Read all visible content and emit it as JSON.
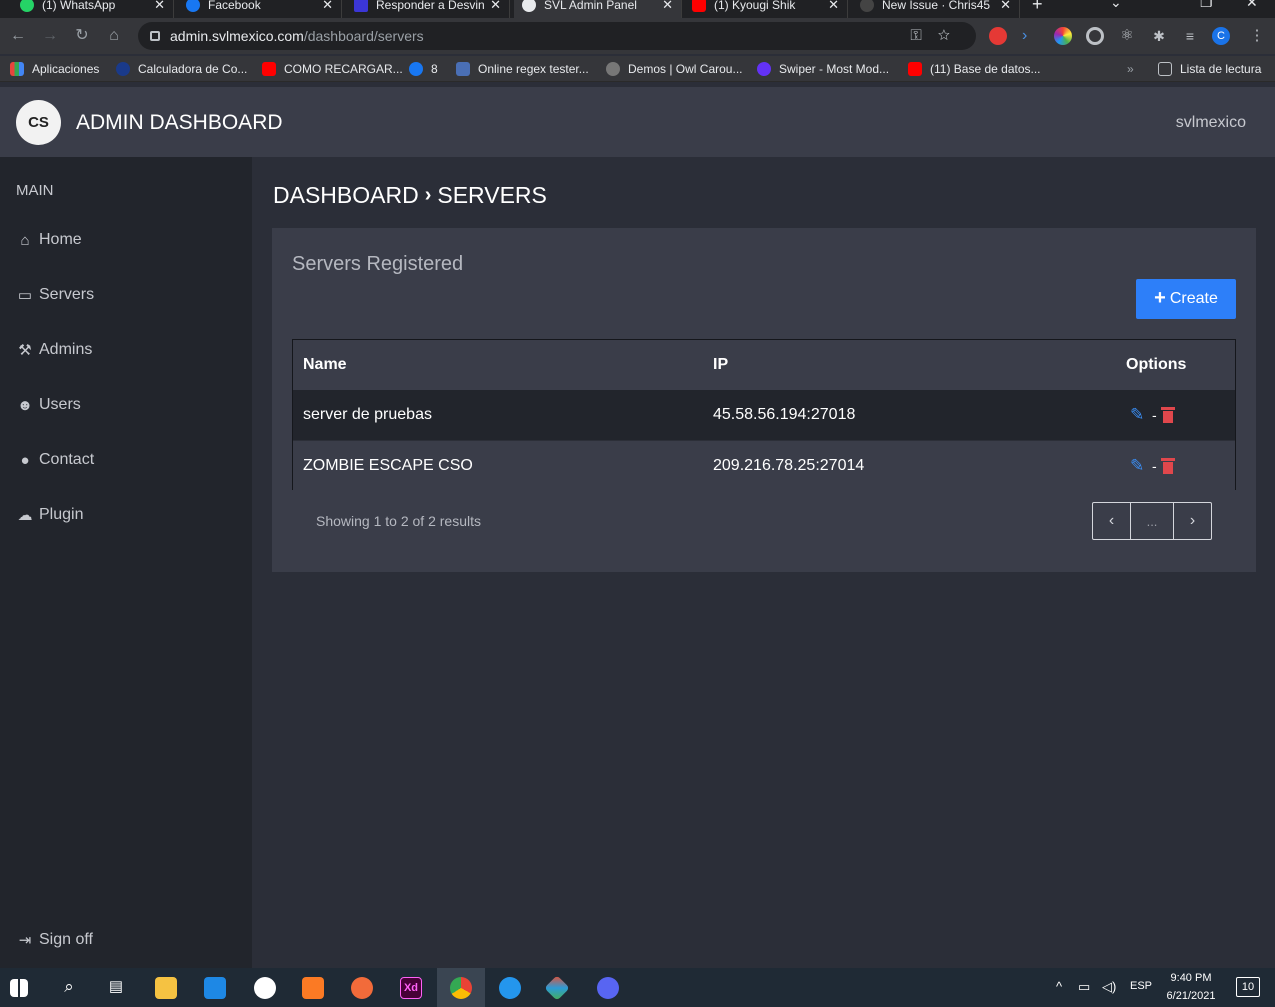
{
  "browser": {
    "tabs": [
      {
        "title": "(1) WhatsApp",
        "color": "#25d366"
      },
      {
        "title": "Facebook",
        "color": "#1877f2"
      },
      {
        "title": "Responder a Desvin",
        "color": "#3b36d6"
      },
      {
        "title": "SVL Admin Panel",
        "color": "#ffffff"
      },
      {
        "title": "(1) Kyougi Shik",
        "color": "#ff0000"
      },
      {
        "title": "New Issue · Chris45",
        "color": "#444444"
      }
    ],
    "url_host": "admin.svlmexico.com",
    "url_path": "/dashboard/servers",
    "bookmarks": [
      {
        "label": "Aplicaciones",
        "color": "#e8453c"
      },
      {
        "label": "Calculadora de Co...",
        "color": "#1a3a8a"
      },
      {
        "label": "COMO RECARGAR...",
        "color": "#ff0000"
      },
      {
        "label": "8",
        "color": "#1877f2"
      },
      {
        "label": "Online regex tester...",
        "color": "#4a6fb5"
      },
      {
        "label": "Demos | Owl Carou...",
        "color": "#777777"
      },
      {
        "label": "Swiper - Most Mod...",
        "color": "#6332f6"
      },
      {
        "label": "(11) Base de datos...",
        "color": "#ff0000"
      }
    ],
    "reading_list": "Lista de lectura",
    "profile_initial": "C"
  },
  "header": {
    "logo_text": "CS",
    "title": "ADMIN DASHBOARD",
    "username": "svlmexico"
  },
  "sidebar": {
    "section": "MAIN",
    "items": [
      {
        "label": "Home",
        "icon": "home-icon"
      },
      {
        "label": "Servers",
        "icon": "hdd-icon"
      },
      {
        "label": "Admins",
        "icon": "hammer-icon"
      },
      {
        "label": "Users",
        "icon": "users-icon"
      },
      {
        "label": "Contact",
        "icon": "github-icon"
      },
      {
        "label": "Plugin",
        "icon": "cloud-download-icon"
      }
    ],
    "signoff": "Sign off"
  },
  "main": {
    "breadcrumb": [
      "DASHBOARD",
      "SERVERS"
    ],
    "card_title": "Servers Registered",
    "create_label": "Create",
    "table": {
      "headers": [
        "Name",
        "IP",
        "Options"
      ],
      "rows": [
        {
          "name": "server de pruebas",
          "ip": "45.58.56.194:27018"
        },
        {
          "name": "ZOMBIE ESCAPE CSO",
          "ip": "209.216.78.25:27014"
        }
      ]
    },
    "showing": "Showing 1 to 2 of 2 results",
    "pager": {
      "prev": "‹",
      "dots": "...",
      "next": "›"
    }
  },
  "taskbar": {
    "lang": "ESP",
    "time": "9:40 PM",
    "date": "6/21/2021",
    "notifications": "10"
  },
  "colors": {
    "accent": "#2d7ff9",
    "danger": "#e0474c",
    "edit": "#3a8cf0"
  }
}
